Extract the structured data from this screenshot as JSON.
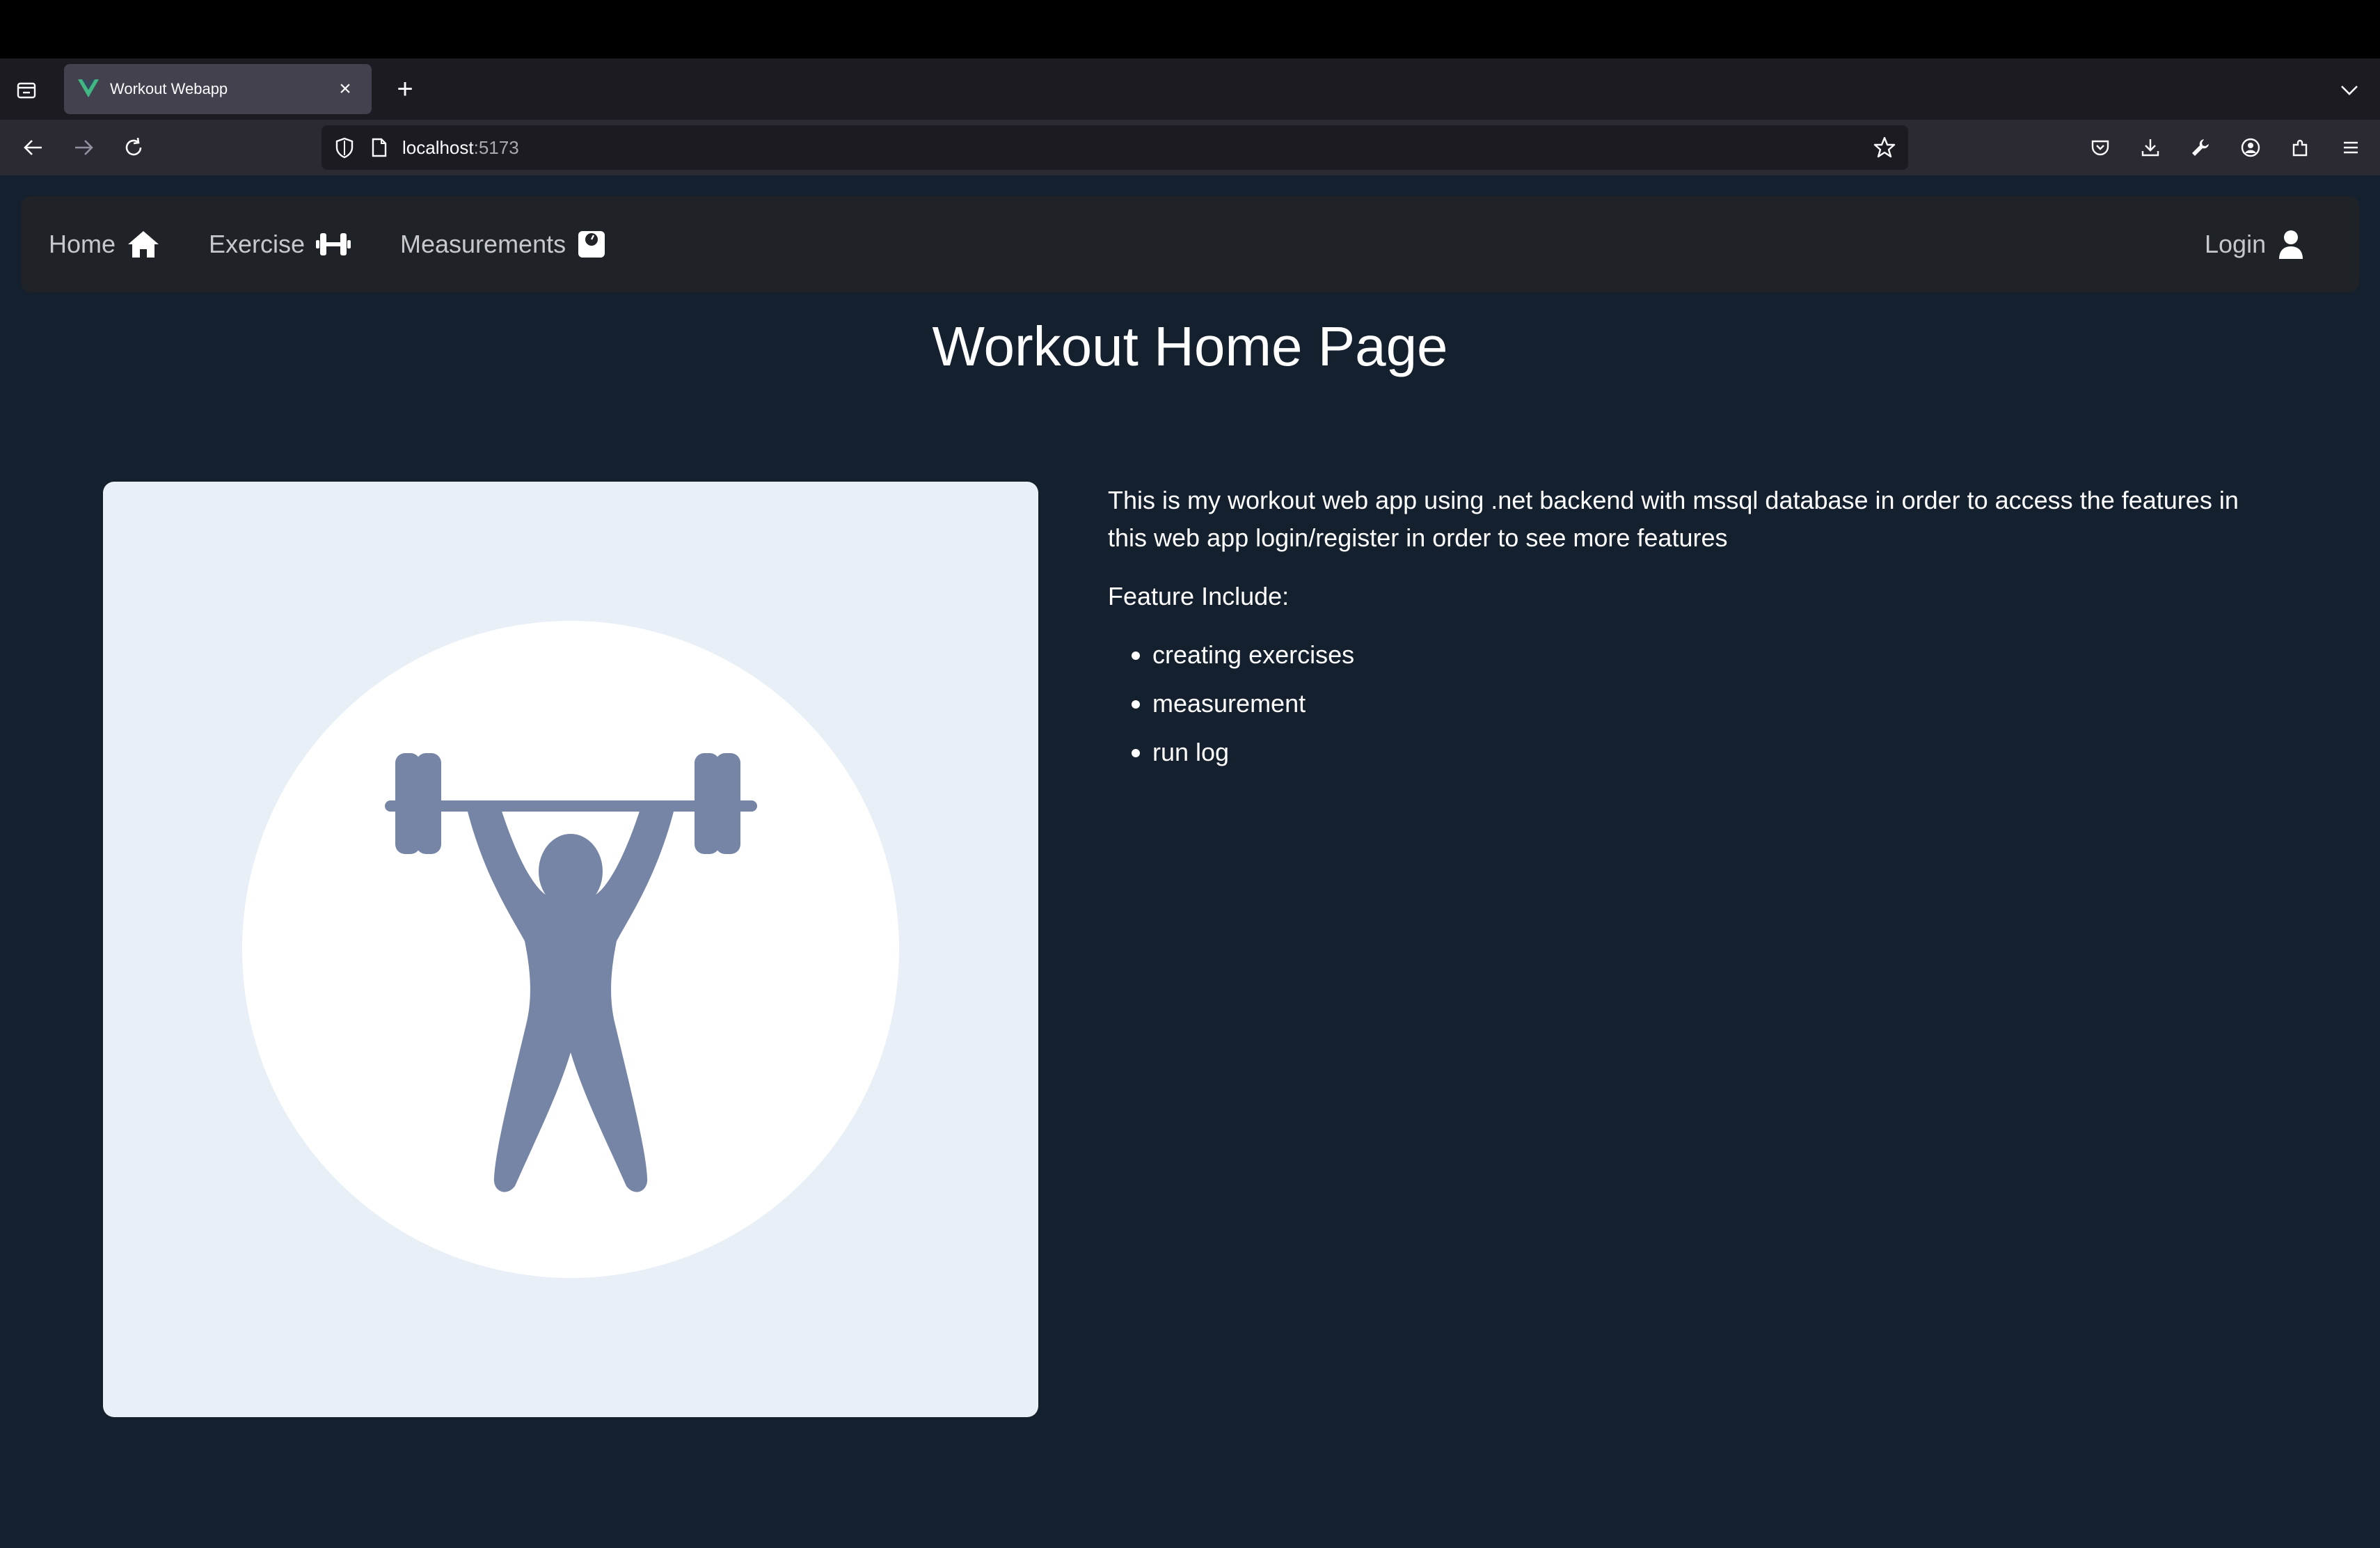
{
  "browser": {
    "tab": {
      "title": "Workout Webapp",
      "close": "×"
    },
    "new_tab": "+",
    "url": {
      "host": "localhost",
      "port": ":5173"
    }
  },
  "app_nav": {
    "home": "Home",
    "exercise": "Exercise",
    "measurements": "Measurements",
    "login": "Login"
  },
  "main": {
    "title": "Workout Home Page",
    "description": "This is my workout web app using .net backend with mssql database in order to access the features in this web app login/register in order to see more features",
    "features_heading": "Feature Include:",
    "features": [
      "creating exercises",
      "measurement",
      "run log"
    ]
  },
  "colors": {
    "page_bg": "#15202f",
    "navbar_bg": "#1f2226",
    "hero_card_bg": "#e8eff7",
    "figure": "#7685a6",
    "vue_green": "#41b883"
  }
}
